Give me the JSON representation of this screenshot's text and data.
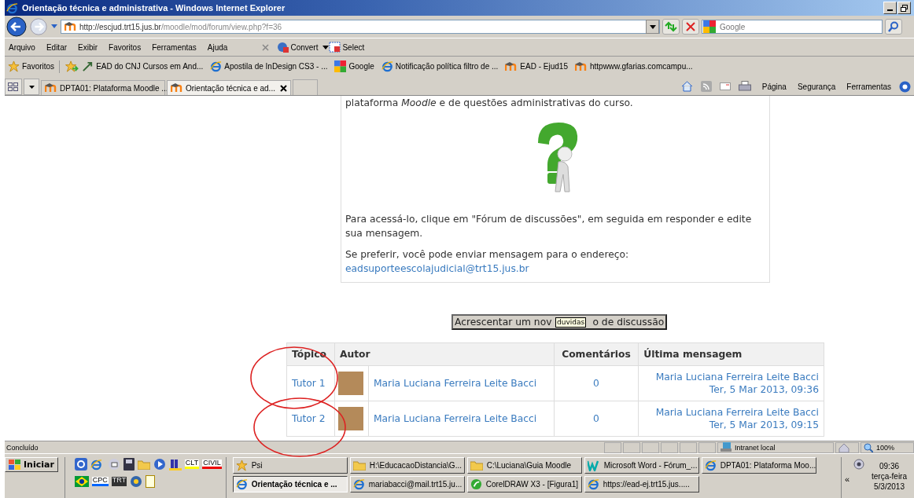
{
  "window": {
    "title": "Orientação técnica e administrativa - Windows Internet Explorer"
  },
  "address_bar": {
    "url_host": "http://escjud.trt15.jus.br",
    "url_path": "/moodle/mod/forum/view.php?f=36"
  },
  "search": {
    "placeholder": "Google"
  },
  "menu": [
    "Arquivo",
    "Editar",
    "Exibir",
    "Favoritos",
    "Ferramentas",
    "Ajuda"
  ],
  "toolbar": {
    "convert": "Convert",
    "select": "Select"
  },
  "favorites": {
    "label": "Favoritos",
    "items": [
      {
        "label": "EAD do CNJ Cursos em And...",
        "kind": "arrow"
      },
      {
        "label": "Apostila de InDesign CS3 - ...",
        "kind": "ie"
      },
      {
        "label": "Google",
        "kind": "google"
      },
      {
        "label": "Notificação política filtro de ...",
        "kind": "ie"
      },
      {
        "label": "EAD - Ejud15",
        "kind": "moodle"
      },
      {
        "label": "httpwww.gfarias.comcampu...",
        "kind": "moodle"
      }
    ]
  },
  "tabs": [
    {
      "label": "DPTA01: Plataforma Moodle ...",
      "selected": false
    },
    {
      "label": "Orientação técnica e ad...",
      "selected": true
    }
  ],
  "command_bar": [
    "Página",
    "Segurança",
    "Ferramentas"
  ],
  "content": {
    "intro": "plataforma *Moodle* e de questões administrativas do curso.",
    "instructions": "Para acessá-lo, clique em \"Fórum de discussões\", em seguida em responder e edite sua mensagem.",
    "alternative": "Se preferir, você pode enviar mensagem para o endereço:",
    "email": "eadsuporteescolajudicial@trt15.jus.br"
  },
  "add_button": {
    "label_before": "Acrescentar um nov",
    "label_after": "o de discussão",
    "tooltip": "duvidas"
  },
  "table": {
    "columns": [
      "Tópico",
      "Autor",
      "Comentários",
      "Última mensagem"
    ],
    "rows": [
      {
        "topic": "Tutor 1",
        "author": "Maria Luciana Ferreira Leite Bacci",
        "comments": "0",
        "last_author": "Maria Luciana Ferreira Leite Bacci",
        "last_date": "Ter, 5 Mar 2013, 09:36"
      },
      {
        "topic": "Tutor 2",
        "author": "Maria Luciana Ferreira Leite Bacci",
        "comments": "0",
        "last_author": "Maria Luciana Ferreira Leite Bacci",
        "last_date": "Ter, 5 Mar 2013, 09:15"
      }
    ]
  },
  "status_bar": {
    "text": "Concluído",
    "zone": "Intranet local",
    "zoom": "100%"
  },
  "taskbar": {
    "start": "Iniciar",
    "quick_launch": [
      "CLT",
      "CIVIL",
      "CPC",
      "TRT"
    ],
    "buttons": [
      {
        "label": "Psi",
        "kind": "star",
        "selected": false
      },
      {
        "label": "H:\\EducacaoDistancia\\G...",
        "kind": "folder",
        "selected": false
      },
      {
        "label": "C:\\Luciana\\Guia Moodle",
        "kind": "folder",
        "selected": false
      },
      {
        "label": "Microsoft Word - Fórum_...",
        "kind": "word",
        "selected": false
      },
      {
        "label": "DPTA01: Plataforma Moo...",
        "kind": "ie",
        "selected": false
      },
      {
        "label": "Orientação técnica e ...",
        "kind": "ie",
        "selected": true
      },
      {
        "label": "mariabacci@mail.trt15.ju...",
        "kind": "ie",
        "selected": false
      },
      {
        "label": "CorelDRAW X3 - [Figura1]",
        "kind": "corel",
        "selected": false
      },
      {
        "label": "https://ead-ej.trt15.jus.....",
        "kind": "ie",
        "selected": false
      }
    ],
    "clock": {
      "time": "09:36",
      "day": "terça-feira",
      "date": "5/3/2013",
      "expand": "«"
    }
  }
}
